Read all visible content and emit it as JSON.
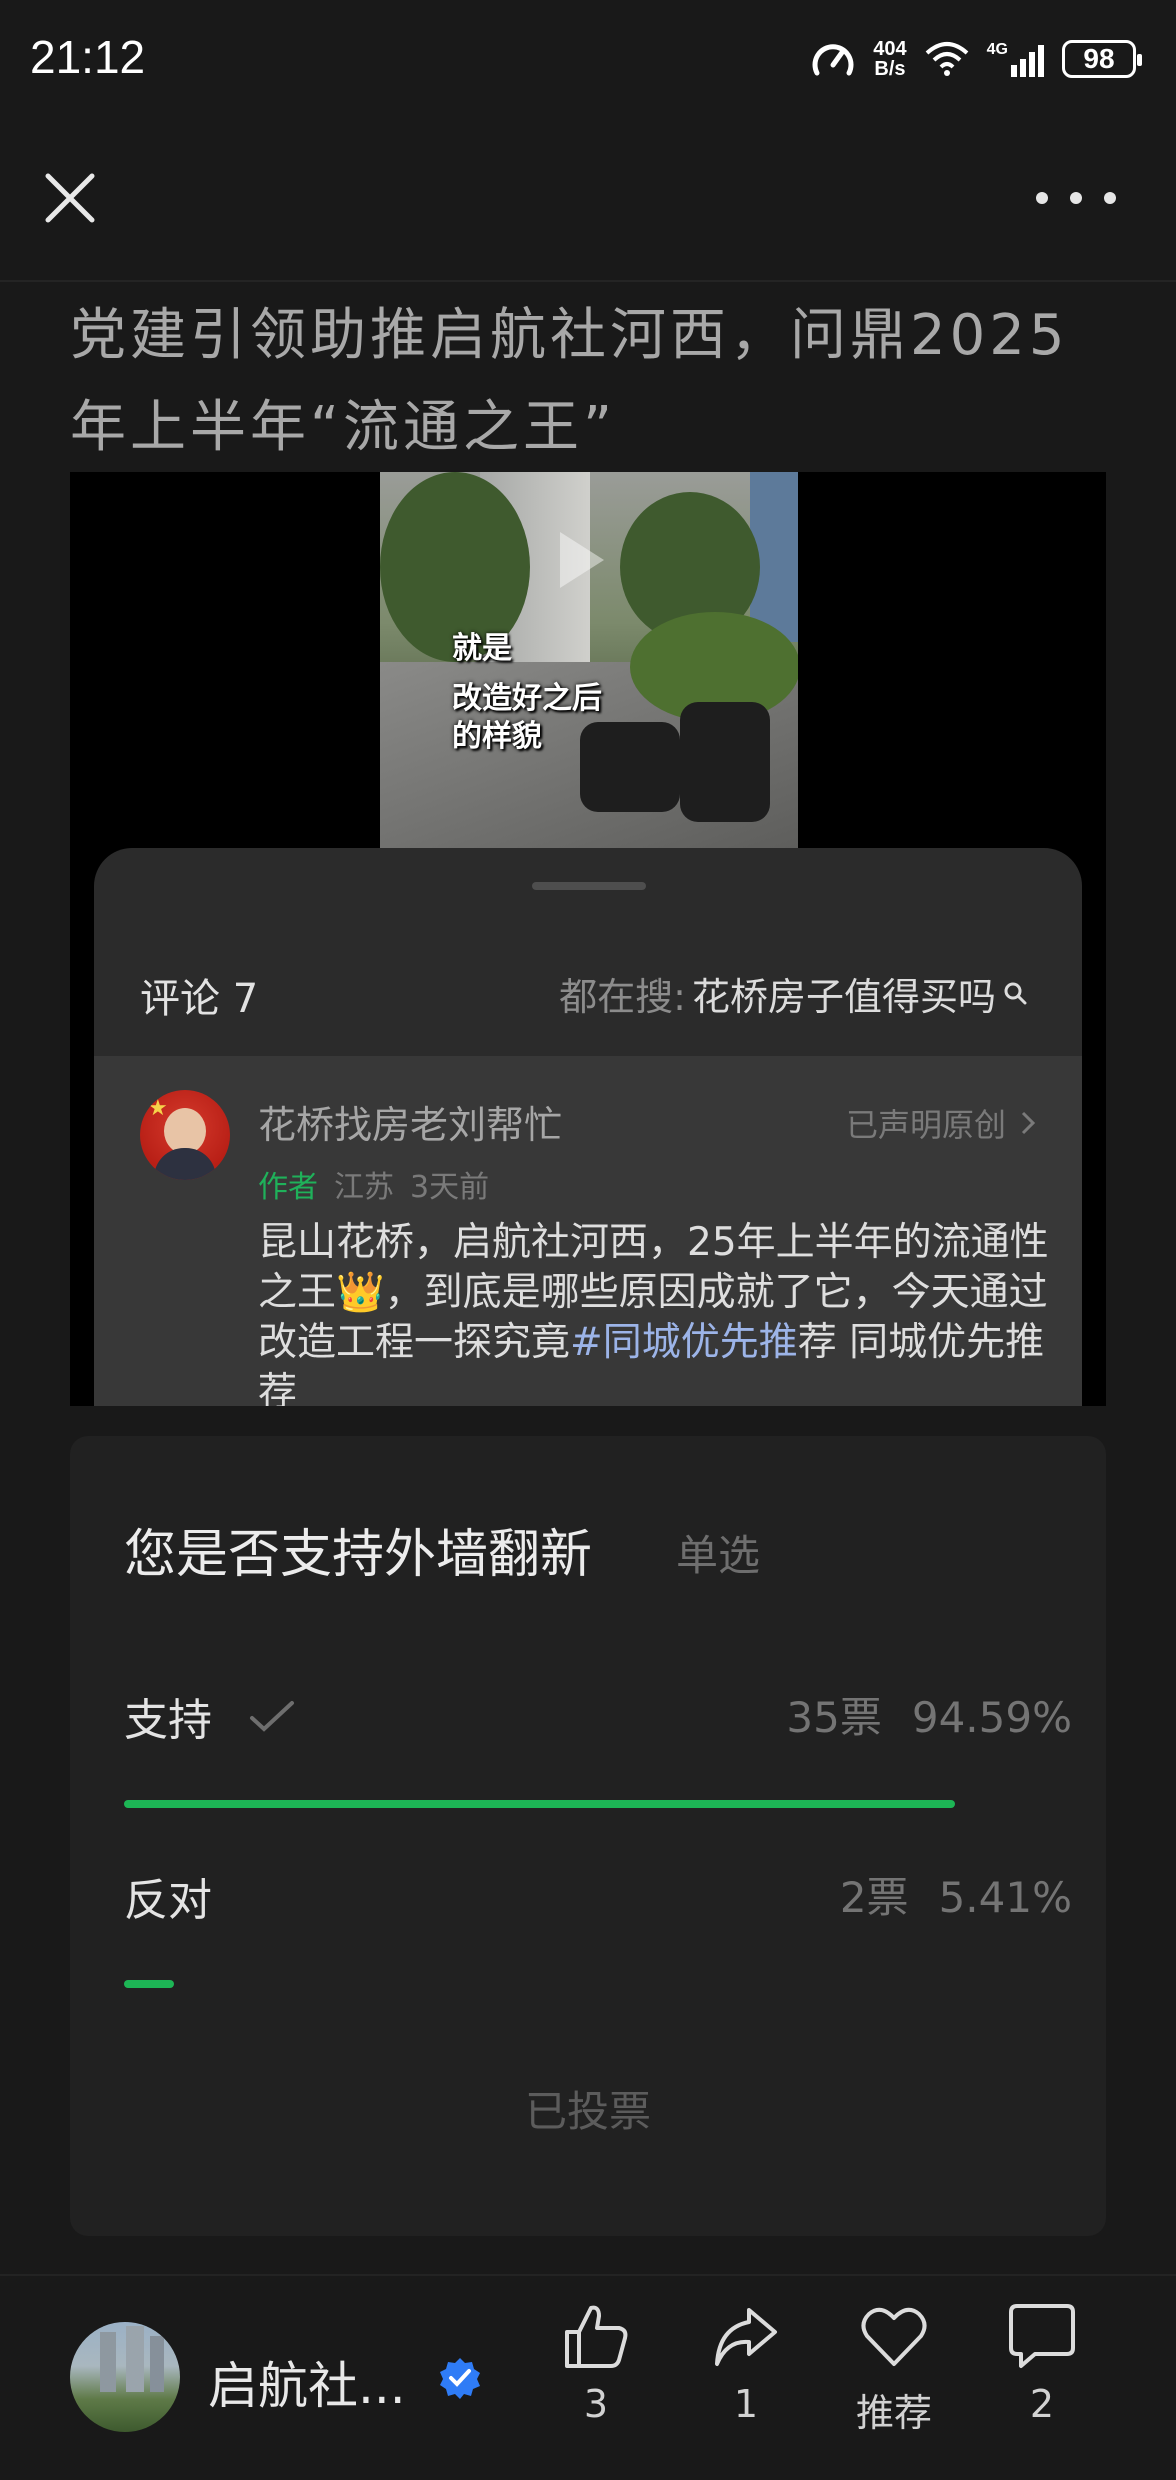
{
  "status_bar": {
    "time": "21:12",
    "net_speed_value": "404",
    "net_speed_unit": "B/s",
    "network_type": "4G",
    "battery": "98"
  },
  "article": {
    "title": "党建引领助推启航社河西，问鼎2025年上半年“流通之王”"
  },
  "video": {
    "caption_line1": "就是",
    "caption_line2": "改造好之后",
    "caption_line3": "的样貌"
  },
  "comments": {
    "header": "评论 7",
    "search_label": "都在搜:",
    "search_query": "花桥房子值得买吗",
    "first_comment": {
      "author": "花桥找房老刘帮忙",
      "original_tag": "已声明原创",
      "author_badge": "作者",
      "region": "江苏",
      "time": "3天前",
      "text_part1": "昆山花桥，启航社河西，25年上半年的流通性之王",
      "emoji": "👑",
      "text_part2": "，到底是哪些原因成就了它，今天通过改造工程一探究竟",
      "hashtag": "#同城优先推",
      "text_part3": "荐 同城优先推荐"
    }
  },
  "poll": {
    "question": "您是否支持外墙翻新",
    "type": "单选",
    "options": [
      {
        "label": "支持",
        "votes": "35票",
        "percent": "94.59%",
        "share": 0.9459,
        "selected": true
      },
      {
        "label": "反对",
        "votes": "2票",
        "percent": "5.41%",
        "share": 0.0541,
        "selected": false
      }
    ],
    "status": "已投票"
  },
  "bottom_bar": {
    "account_name": "启航社...",
    "likes": "3",
    "shares": "1",
    "recommend_label": "推荐",
    "comments": "2"
  },
  "colors": {
    "accent_green": "#1db555",
    "verified_blue": "#2f7cf6",
    "background": "#191919"
  },
  "icons": [
    "close-icon",
    "more-icon",
    "search-icon",
    "chevron-right-icon",
    "checkmark-icon",
    "thumbs-up-icon",
    "share-icon",
    "heart-icon",
    "comment-icon",
    "verified-icon"
  ]
}
